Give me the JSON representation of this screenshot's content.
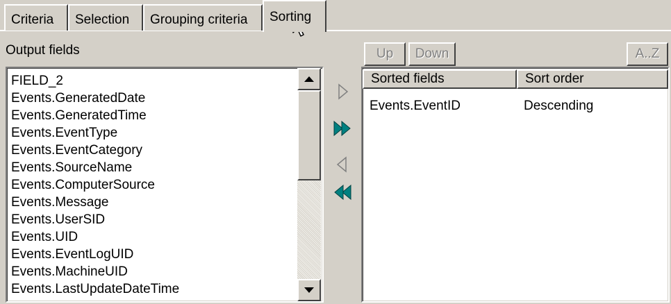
{
  "tabs": [
    {
      "label": "Criteria",
      "active": false
    },
    {
      "label": "Selection",
      "active": false
    },
    {
      "label": "Grouping criteria",
      "active": false
    },
    {
      "label": "Sorting",
      "active": true
    }
  ],
  "output_fields": {
    "label": "Output fields",
    "items": [
      "FIELD_2",
      "Events.GeneratedDate",
      "Events.GeneratedTime",
      "Events.EventType",
      "Events.EventCategory",
      "Events.SourceName",
      "Events.ComputerSource",
      "Events.Message",
      "Events.UserSID",
      "Events.UID",
      "Events.EventLogUID",
      "Events.MachineUID",
      "Events.LastUpdateDateTime"
    ]
  },
  "toolbar": {
    "up_label": "Up",
    "down_label": "Down",
    "az_label": "A..Z"
  },
  "transfer_buttons": {
    "add_one": "triangle-right-icon",
    "add_all": "double-triangle-right-icon",
    "remove_one": "triangle-left-icon",
    "remove_all": "double-triangle-left-icon"
  },
  "sorted_grid": {
    "columns": [
      "Sorted fields",
      "Sort order"
    ],
    "rows": [
      {
        "field": "Events.EventID",
        "order": "Descending"
      }
    ]
  },
  "colors": {
    "face": "#d4d0c8",
    "teal_arrow": "#008080",
    "disabled_text": "#808080"
  }
}
